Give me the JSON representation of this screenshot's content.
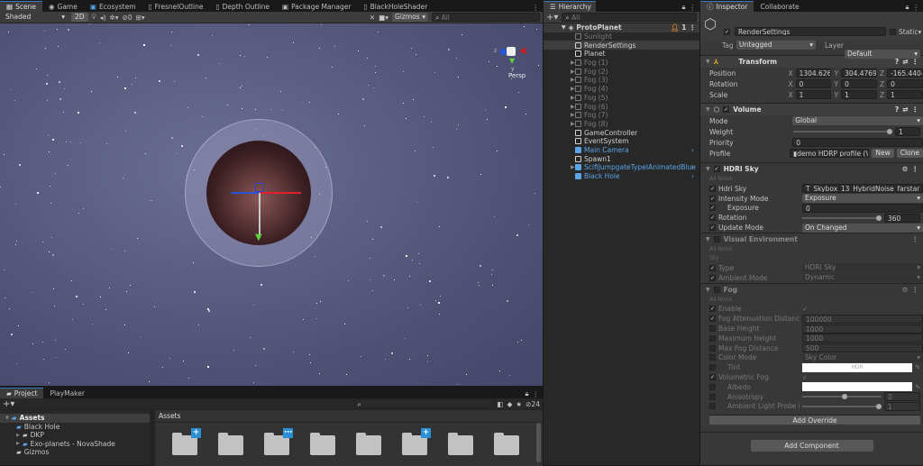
{
  "scene_tabs": [
    "Scene",
    "Game",
    "Ecosystem",
    "FresnelOutline",
    "Depth Outline",
    "Package Manager",
    "BlackHoleShader"
  ],
  "scene_toolbar": {
    "shading": "Shaded",
    "mode_2d": "2D",
    "hidden_count": "0",
    "gizmos": "Gizmos",
    "search_placeholder": "All",
    "persp": "Persp",
    "axis_x": "x",
    "axis_y": "y",
    "axis_z": "z"
  },
  "hierarchy": {
    "title": "Hierarchy",
    "search_placeholder": "All",
    "scene_name": "ProtoPlanet",
    "scene_badge": "1",
    "items": [
      {
        "label": "Sunlight",
        "style": "dim"
      },
      {
        "label": "RenderSettings",
        "style": "sel"
      },
      {
        "label": "Planet",
        "style": ""
      },
      {
        "label": "Fog (1)",
        "style": "dim",
        "arrow": true
      },
      {
        "label": "Fog (2)",
        "style": "dim",
        "arrow": true
      },
      {
        "label": "Fog (3)",
        "style": "dim",
        "arrow": true
      },
      {
        "label": "Fog (4)",
        "style": "dim",
        "arrow": true
      },
      {
        "label": "Fog (5)",
        "style": "dim",
        "arrow": true
      },
      {
        "label": "Fog (6)",
        "style": "dim",
        "arrow": true
      },
      {
        "label": "Fog (7)",
        "style": "dim",
        "arrow": true
      },
      {
        "label": "Fog (8)",
        "style": "dim",
        "arrow": true
      },
      {
        "label": "GameController",
        "style": ""
      },
      {
        "label": "EventSystem",
        "style": ""
      },
      {
        "label": "Main Camera",
        "style": "blue"
      },
      {
        "label": "Spawn1",
        "style": ""
      },
      {
        "label": "ScifiJumpgateTypeIAnimatedBlue",
        "style": "blue",
        "arrow": true
      },
      {
        "label": "Black Hole",
        "style": "blue"
      }
    ]
  },
  "inspector": {
    "tabs": [
      "Inspector",
      "Collaborate"
    ],
    "object_name": "RenderSettings",
    "static_label": "Static",
    "tag_label": "Tag",
    "tag": "Untagged",
    "layer_label": "Layer",
    "layer": "Default",
    "transform": {
      "title": "Transform",
      "position_label": "Position",
      "rotation_label": "Rotation",
      "scale_label": "Scale",
      "position": [
        "1304.626",
        "304.4769",
        "-165.4404"
      ],
      "rotation": [
        "0",
        "0",
        "0"
      ],
      "scale": [
        "1",
        "1",
        "1"
      ],
      "axes": [
        "X",
        "Y",
        "Z"
      ]
    },
    "volume": {
      "title": "Volume",
      "mode_label": "Mode",
      "mode": "Global",
      "weight_label": "Weight",
      "weight": "1",
      "priority_label": "Priority",
      "priority": "0",
      "profile_label": "Profile",
      "profile": "demo HDRP profile (V",
      "new_label": "New",
      "clone_label": "Clone"
    },
    "all_label": "All",
    "none_label": "None",
    "hdri": {
      "title": "HDRI Sky",
      "sky_label": "Hdri Sky",
      "sky": "T_Skybox_13_HybridNoise_farstar",
      "intensity_label": "Intensity Mode",
      "intensity": "Exposure",
      "exposure_label": "Exposure",
      "exposure": "0",
      "rotation_label": "Rotation",
      "rotation": "360",
      "update_label": "Update Mode",
      "update": "On Changed"
    },
    "visual_env": {
      "title": "Visual Environment",
      "sky_section": "Sky",
      "type_label": "Type",
      "type": "HDRI Sky",
      "ambient_label": "Ambient Mode",
      "ambient": "Dynamic"
    },
    "fog": {
      "title": "Fog",
      "enable_label": "Enable",
      "atten_label": "Fog Attenuation Distance",
      "atten": "100000",
      "base_label": "Base Height",
      "base": "1000",
      "max_h_label": "Maximum Height",
      "max_h": "1000",
      "max_d_label": "Max Fog Distance",
      "max_d": "500",
      "color_mode_label": "Color Mode",
      "color_mode": "Sky Color",
      "tint_label": "Tint",
      "tint_hdr": "HDR",
      "vol_label": "Volumetric Fog",
      "albedo_label": "Albedo",
      "aniso_label": "Anisotropy",
      "aniso": "0",
      "probe_label": "Ambient Light Probe Dir",
      "probe": "1"
    },
    "add_override": "Add Override",
    "add_component": "Add Component"
  },
  "project": {
    "tabs": [
      "Project",
      "PlayMaker"
    ],
    "hidden_count": "24",
    "breadcrumb": "Assets",
    "tree": [
      "Assets",
      "Black Hole",
      "DKP",
      "Exo-planets - NovaShade",
      "Gizmos"
    ]
  },
  "colors": {
    "accent": "#3a79bb",
    "selection_blue": "#5aa5e8",
    "badge": "#2b8fd6"
  }
}
